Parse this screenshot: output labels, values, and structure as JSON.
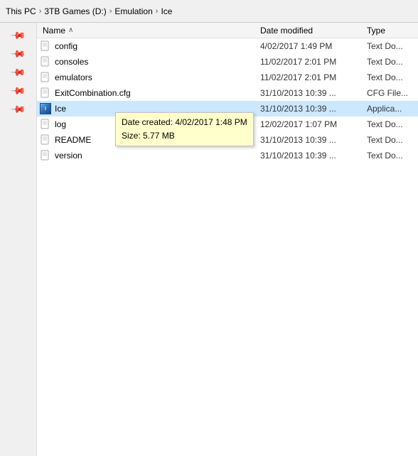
{
  "titlebar": {
    "breadcrumbs": [
      {
        "label": "This PC",
        "sep": "›"
      },
      {
        "label": "3TB Games (D:)",
        "sep": "›"
      },
      {
        "label": "Emulation",
        "sep": "›"
      },
      {
        "label": "Ice",
        "sep": ""
      }
    ]
  },
  "columns": {
    "name": "Name",
    "sort_arrow": "∧",
    "date_modified": "Date modified",
    "type": "Type"
  },
  "files": [
    {
      "name": "config",
      "icon": "doc",
      "date": "4/02/2017 1:49 PM",
      "type": "Text Do..."
    },
    {
      "name": "consoles",
      "icon": "doc",
      "date": "11/02/2017 2:01 PM",
      "type": "Text Do..."
    },
    {
      "name": "emulators",
      "icon": "doc",
      "date": "11/02/2017 2:01 PM",
      "type": "Text Do..."
    },
    {
      "name": "ExitCombination.cfg",
      "icon": "doc",
      "date": "31/10/2013 10:39 ...",
      "type": "CFG File..."
    },
    {
      "name": "Ice",
      "icon": "app",
      "date": "31/10/2013 10:39 ...",
      "type": "Applica...",
      "selected": true
    },
    {
      "name": "log",
      "icon": "doc",
      "date": "12/02/2017 1:07 PM",
      "type": "Text Do..."
    },
    {
      "name": "README",
      "icon": "doc",
      "date": "31/10/2013 10:39 ...",
      "type": "Text Do..."
    },
    {
      "name": "version",
      "icon": "doc",
      "date": "31/10/2013 10:39 ...",
      "type": "Text Do..."
    }
  ],
  "tooltip": {
    "line1": "Date created: 4/02/2017 1:48 PM",
    "line2": "Size: 5.77 MB"
  },
  "sidebar": {
    "pins": [
      "📌",
      "📌",
      "📌",
      "📌",
      "📌"
    ]
  }
}
